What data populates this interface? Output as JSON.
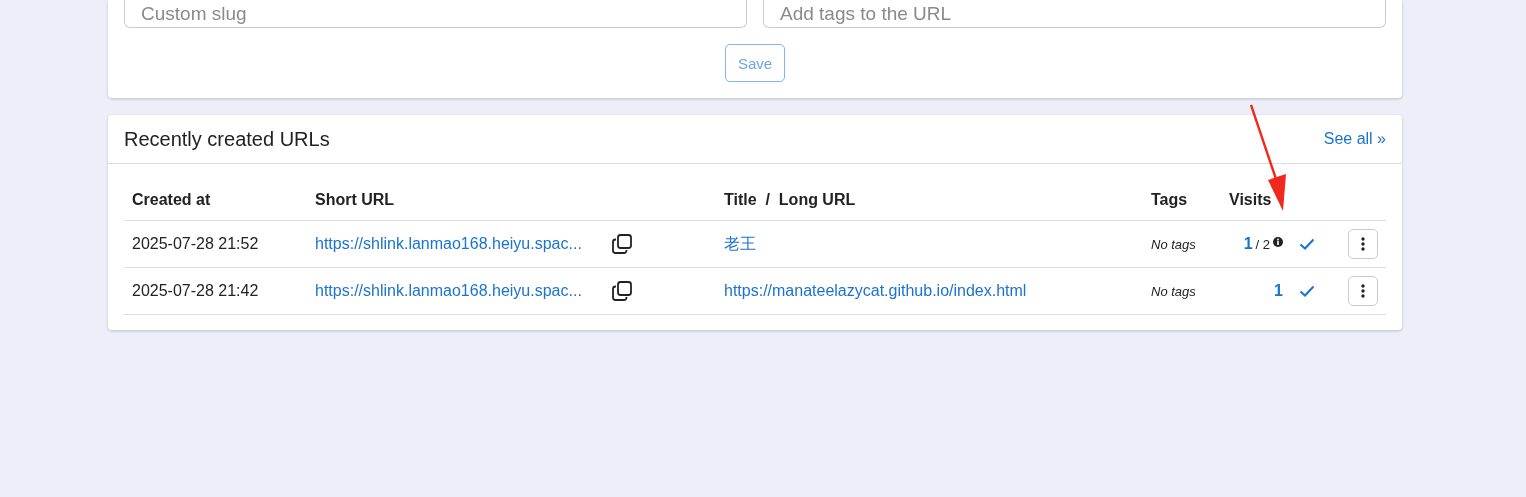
{
  "create_form": {
    "slug_field": {
      "placeholder": "Custom slug"
    },
    "tags_field": {
      "placeholder": "Add tags to the URL"
    },
    "save_button": "Save"
  },
  "recent": {
    "title": "Recently created URLs",
    "see_all": "See all »",
    "columns": [
      "Created at",
      "Short URL",
      "Title  /  Long URL",
      "Tags",
      "Visits"
    ],
    "rows": [
      {
        "created_at": "2025-07-28 21:52",
        "short_url": "https://shlink.lanmao168.heiyu.spac...",
        "title": "老王",
        "tags": "No tags",
        "visits": "1",
        "max_visits": "/ 2"
      },
      {
        "created_at": "2025-07-28 21:42",
        "short_url": "https://shlink.lanmao168.heiyu.spac...",
        "title": "https://manateelazycat.github.io/index.html",
        "tags": "No tags",
        "visits": "1"
      }
    ]
  }
}
